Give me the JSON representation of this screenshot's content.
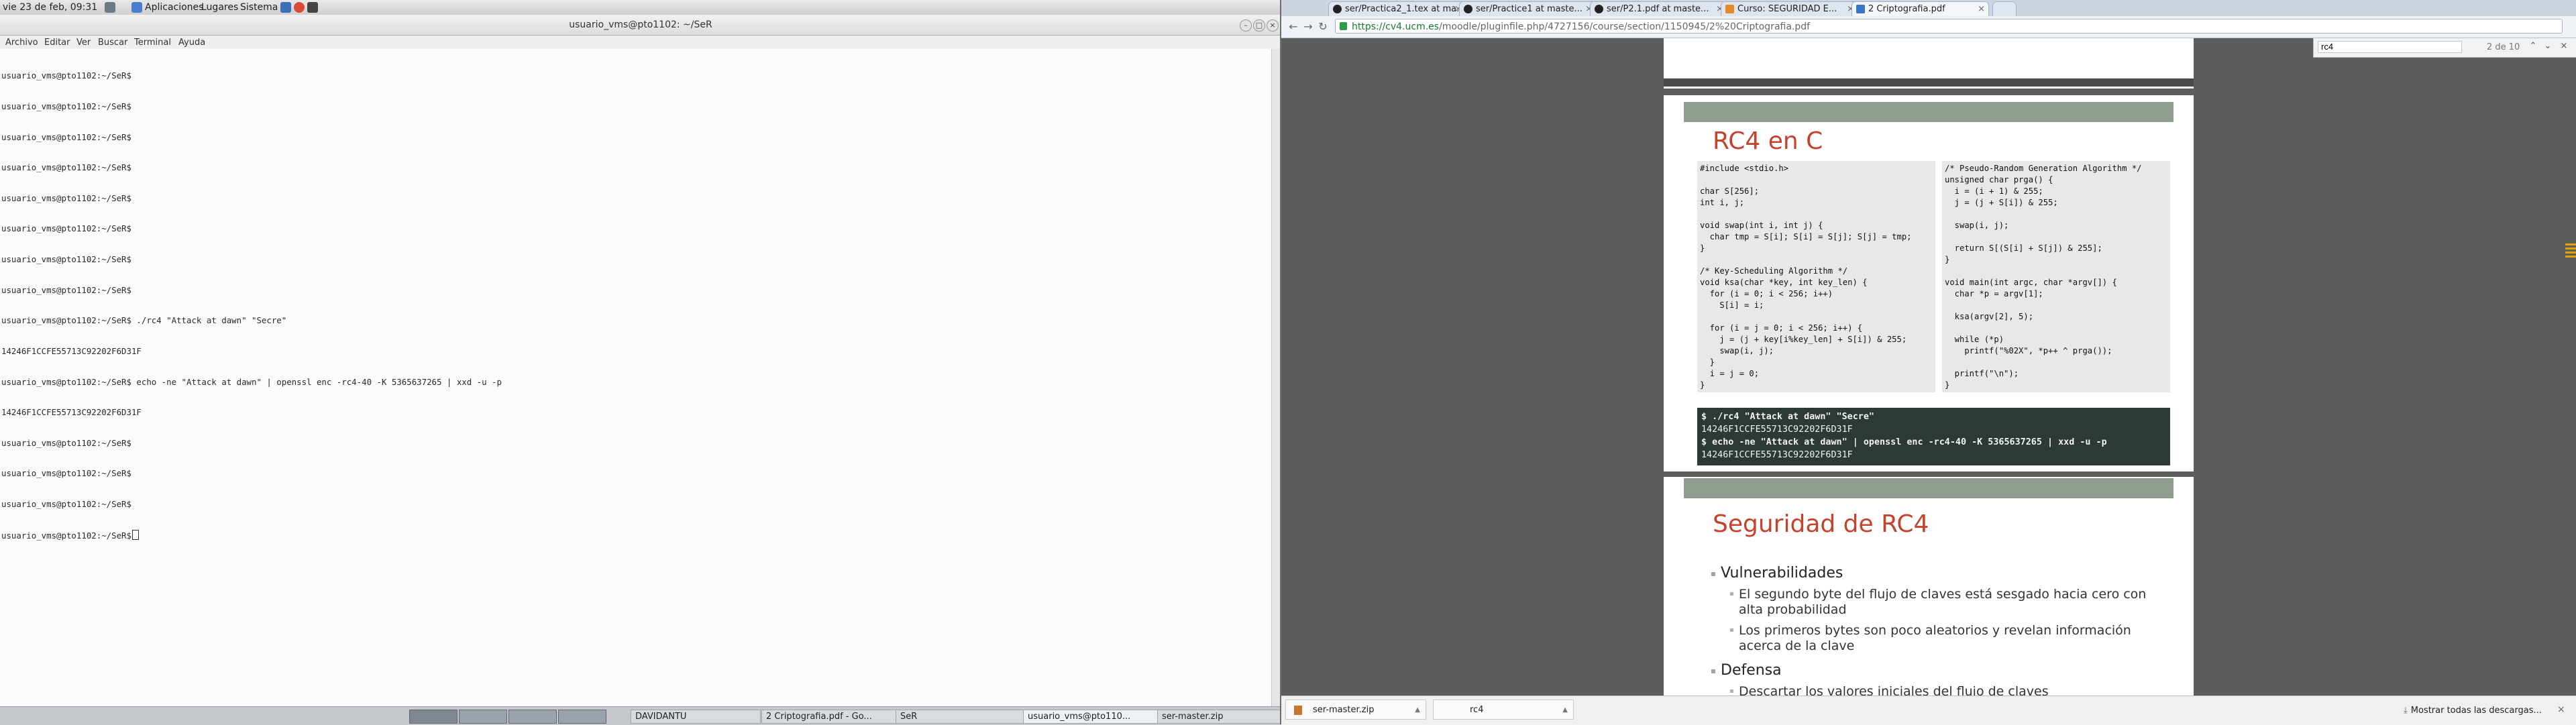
{
  "gnome": {
    "clock": "vie 23 de feb, 09:31",
    "menus": [
      "Aplicaciones",
      "Lugares",
      "Sistema"
    ],
    "taskbar": [
      "DAVIDANTU",
      "2 Criptografia.pdf - Go...",
      "SeR",
      "usuario_vms@pto110...",
      "ser-master.zip"
    ]
  },
  "terminal": {
    "title": "usuario_vms@pto1102: ~/SeR",
    "menu": [
      "Archivo",
      "Editar",
      "Ver",
      "Buscar",
      "Terminal",
      "Ayuda"
    ],
    "lines": [
      "usuario_vms@pto1102:~/SeR$",
      "usuario_vms@pto1102:~/SeR$",
      "usuario_vms@pto1102:~/SeR$",
      "usuario_vms@pto1102:~/SeR$",
      "usuario_vms@pto1102:~/SeR$",
      "usuario_vms@pto1102:~/SeR$",
      "usuario_vms@pto1102:~/SeR$",
      "usuario_vms@pto1102:~/SeR$",
      "usuario_vms@pto1102:~/SeR$ ./rc4 \"Attack at dawn\" \"Secre\"",
      "14246F1CCFE55713C92202F6D31F",
      "usuario_vms@pto1102:~/SeR$ echo -ne \"Attack at dawn\" | openssl enc -rc4-40 -K 5365637265 | xxd -u -p",
      "14246F1CCFE55713C92202F6D31F",
      "usuario_vms@pto1102:~/SeR$",
      "usuario_vms@pto1102:~/SeR$",
      "usuario_vms@pto1102:~/SeR$",
      "usuario_vms@pto1102:~/SeR$"
    ]
  },
  "browser": {
    "tabs": [
      "ser/Practica2_1.tex at ma...",
      "ser/Practice1 at maste...",
      "ser/P2.1.pdf at maste...",
      "Curso: SEGURIDAD E...",
      "2 Criptografia.pdf"
    ],
    "url_secure": "https://cv4.ucm.es",
    "url_rest": "/moodle/pluginfile.php/4727156/course/section/1150945/2%20Criptografia.pdf",
    "find": {
      "query": "rc4",
      "count": "2 de 10"
    },
    "downloads": [
      {
        "name": "ser-master.zip"
      },
      {
        "name": "rc4"
      }
    ],
    "show_all": "Mostrar todas las descargas..."
  },
  "slide_rc4_c": {
    "title": "RC4 en C",
    "code_left": "#include <stdio.h>\n\nchar S[256];\nint i, j;\n\nvoid swap(int i, int j) {\n  char tmp = S[i]; S[i] = S[j]; S[j] = tmp;\n}\n\n/* Key-Scheduling Algorithm */\nvoid ksa(char *key, int key_len) {\n  for (i = 0; i < 256; i++)\n    S[i] = i;\n\n  for (i = j = 0; i < 256; i++) {\n    j = (j + key[i%key_len] + S[i]) & 255;\n    swap(i, j);\n  }\n  i = j = 0;\n}",
    "code_right": "/* Pseudo-Random Generation Algorithm */\nunsigned char prga() {\n  i = (i + 1) & 255;\n  j = (j + S[i]) & 255;\n\n  swap(i, j);\n\n  return S[(S[i] + S[j]) & 255];\n}\n\nvoid main(int argc, char *argv[]) {\n  char *p = argv[1];\n\n  ksa(argv[2], 5);\n\n  while (*p)\n    printf(\"%02X\", *p++ ^ prga());\n\n  printf(\"\\n\");\n}",
    "term_cmd1": "$ ./rc4 \"Attack at dawn\" \"Secre\"",
    "term_out1": "14246F1CCFE55713C92202F6D31F",
    "term_cmd2": "$ echo -ne \"Attack at dawn\" | openssl enc -rc4-40 -K 5365637265 | xxd -u -p",
    "term_out2": "14246F1CCFE55713C92202F6D31F"
  },
  "slide_security": {
    "title": "Seguridad de RC4",
    "bullet1": "Vulnerabilidades",
    "sub1": "El segundo byte del flujo de claves está sesgado hacia cero con alta probabilidad",
    "sub2": "Los primeros bytes son poco aleatorios y revelan información acerca de la clave",
    "bullet2": "Defensa",
    "sub3": "Descartar los valores iniciales del flujo de claves"
  },
  "colors": {
    "slide_title": "#c5422d",
    "slide_band": "#8f9e90",
    "terminal_box": "#2c3a33"
  }
}
